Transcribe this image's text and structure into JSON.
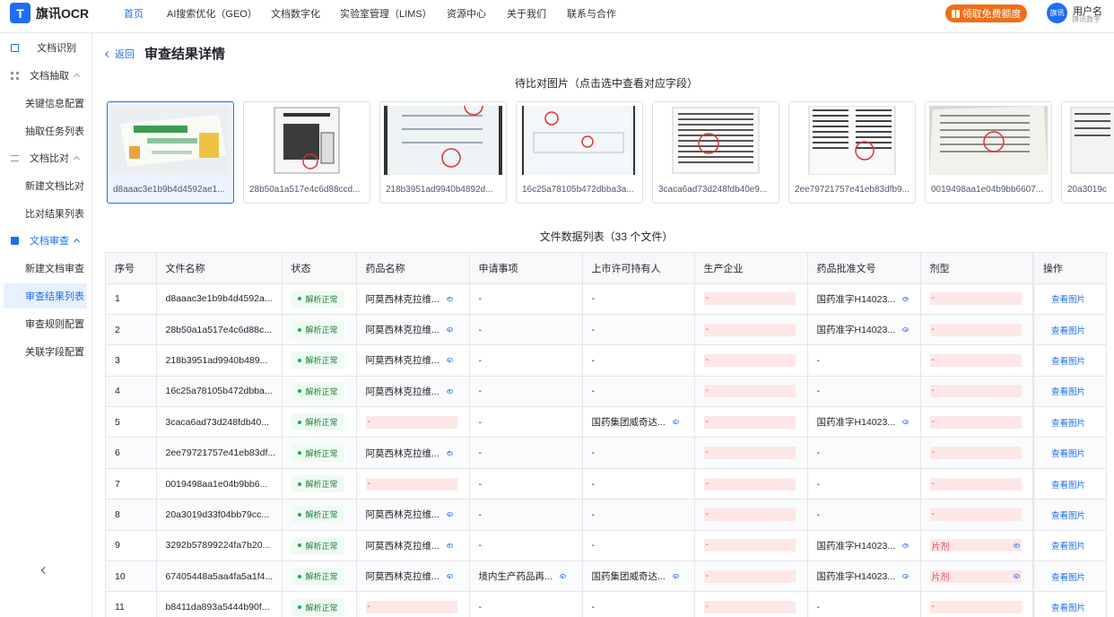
{
  "app": {
    "logo_letter": "T",
    "name": "旗讯OCR"
  },
  "nav": [
    "首页",
    "AI搜索优化（GEO）",
    "文档数字化",
    "实验室管理（LIMS）",
    "资源中心",
    "关于我们",
    "联系与合作"
  ],
  "promo_label": "领取免费额度",
  "user": {
    "avatar": "旗讯",
    "name": "用户名",
    "org": "旗讯数字"
  },
  "sidebar": {
    "items": [
      {
        "label": "文档识别",
        "type": "group",
        "icon": "document-scan-icon"
      },
      {
        "label": "文档抽取",
        "type": "group",
        "icon": "grid-icon"
      },
      {
        "label": "关键信息配置",
        "type": "sub"
      },
      {
        "label": "抽取任务列表",
        "type": "sub"
      },
      {
        "label": "文档比对",
        "type": "group",
        "icon": "swap-icon"
      },
      {
        "label": "新建文档比对",
        "type": "sub"
      },
      {
        "label": "比对结果列表",
        "type": "sub"
      },
      {
        "label": "文档审查",
        "type": "group",
        "icon": "file-check-icon"
      },
      {
        "label": "新建文档审查",
        "type": "sub"
      },
      {
        "label": "审查结果列表",
        "type": "sub",
        "active": true
      },
      {
        "label": "审查规则配置",
        "type": "sub"
      },
      {
        "label": "关联字段配置",
        "type": "sub"
      }
    ]
  },
  "back_label": "返回",
  "page_title": "审查结果详情",
  "compare_title": "待比对图片（点击选中查看对应字段）",
  "thumbnails": [
    "d8aaac3e1b9b4d4592ae1...",
    "28b50a1a517e4c6d88ccd...",
    "218b3951ad9940b4892d...",
    "16c25a78105b472dbba3a...",
    "3caca6ad73d248fdb40e9...",
    "2ee79721757e41eb83dfb9...",
    "0019498aa1e04b9bb6607...",
    "20a3019c"
  ],
  "table_title": "文件数据列表（33 个文件）",
  "columns": [
    "序号",
    "文件名称",
    "状态",
    "药品名称",
    "申请事项",
    "上市许可持有人",
    "生产企业",
    "药品批准文号",
    "剂型",
    "操作"
  ],
  "status_label": "解析正常",
  "action_label": "查看图片",
  "rows": [
    {
      "no": "1",
      "file": "d8aaac3e1b9b4d4592a...",
      "drug": "阿莫西林克拉维...",
      "apply": "-",
      "holder": "-",
      "maker": "-",
      "approval": "国药准字H14023...",
      "form": "-"
    },
    {
      "no": "2",
      "file": "28b50a1a517e4c6d88c...",
      "drug": "阿莫西林克拉维...",
      "apply": "-",
      "holder": "-",
      "maker": "-",
      "approval": "国药准字H14023...",
      "form": "-"
    },
    {
      "no": "3",
      "file": "218b3951ad9940b489...",
      "drug": "阿莫西林克拉维...",
      "apply": "-",
      "holder": "-",
      "maker": "-",
      "approval": "-",
      "form": "-"
    },
    {
      "no": "4",
      "file": "16c25a78105b472dbba...",
      "drug": "阿莫西林克拉维...",
      "apply": "-",
      "holder": "-",
      "maker": "-",
      "approval": "-",
      "form": "-"
    },
    {
      "no": "5",
      "file": "3caca6ad73d248fdb40...",
      "drug": "-",
      "apply": "-",
      "holder": "国药集团威奇达...",
      "maker": "-",
      "approval": "国药准字H14023...",
      "form": "-"
    },
    {
      "no": "6",
      "file": "2ee79721757e41eb83df...",
      "drug": "阿莫西林克拉维...",
      "apply": "-",
      "holder": "-",
      "maker": "-",
      "approval": "-",
      "form": "-"
    },
    {
      "no": "7",
      "file": "0019498aa1e04b9bb6...",
      "drug": "-",
      "apply": "-",
      "holder": "-",
      "maker": "-",
      "approval": "-",
      "form": "-"
    },
    {
      "no": "8",
      "file": "20a3019d33f04bb79cc...",
      "drug": "阿莫西林克拉维...",
      "apply": "-",
      "holder": "-",
      "maker": "-",
      "approval": "-",
      "form": "-"
    },
    {
      "no": "9",
      "file": "3292b57899224fa7b20...",
      "drug": "阿莫西林克拉维...",
      "apply": "-",
      "holder": "-",
      "maker": "-",
      "approval": "国药准字H14023...",
      "form": "片剂"
    },
    {
      "no": "10",
      "file": "67405448a5aa4fa5a1f4...",
      "drug": "阿莫西林克拉维...",
      "apply": "境内生产药品再...",
      "holder": "国药集团威奇达...",
      "maker": "-",
      "approval": "国药准字H14023...",
      "form": "片剂"
    },
    {
      "no": "11",
      "file": "b8411da893a5444b90f...",
      "drug": "-",
      "apply": "-",
      "holder": "-",
      "maker": "-",
      "approval": "-",
      "form": "-"
    }
  ],
  "colors": {
    "accent": "#1d6ff2",
    "promo": "#f06e16",
    "ok_green": "#23a55a",
    "missing_bg": "#fde7e7",
    "missing_text": "#e34d59"
  }
}
